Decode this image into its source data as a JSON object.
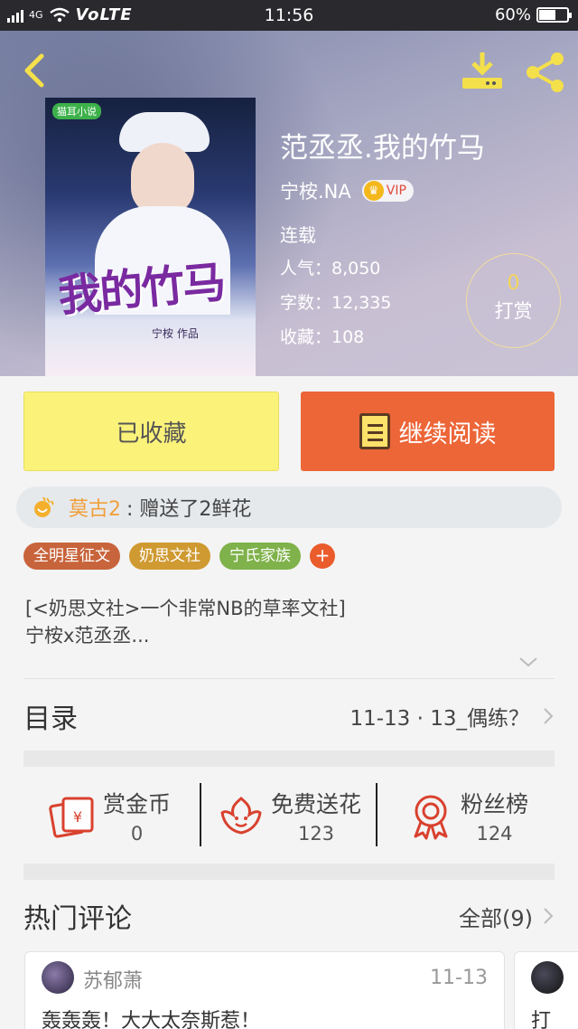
{
  "status_bar": {
    "network": "4G",
    "carrier_mode": "VoLTE",
    "time": "11:56",
    "battery": "60%",
    "battery_level": 0.6
  },
  "book": {
    "title": "范丞丞.我的竹马",
    "author": "宁桉.NA",
    "vip_label": "VIP",
    "status": "连载",
    "popularity": "人气：8,050",
    "word_count": "字数：12,335",
    "favorites": "收藏：108",
    "cover_logo": "猫耳小说",
    "cover_title": "我的竹马",
    "cover_author": "宁桉 作品"
  },
  "tip": {
    "count": "0",
    "label": "打赏"
  },
  "actions": {
    "favorited_label": "已收藏",
    "read_label": "继续阅读"
  },
  "gift": {
    "user": "莫古2",
    "text": ": 赠送了2鲜花"
  },
  "tags": [
    {
      "label": "全明星征文",
      "color": "#c8643c"
    },
    {
      "label": "奶思文社",
      "color": "#cf9a32"
    },
    {
      "label": "宁氏家族",
      "color": "#7fb24a"
    }
  ],
  "tag_add": "+",
  "intro": {
    "line1": "[<奶思文社>一个非常NB的草率文社]",
    "line2": "宁桉x范丞丞..."
  },
  "toc": {
    "title": "目录",
    "latest": "11-13 · 13_偶练？"
  },
  "stats": [
    {
      "label": "赏金币",
      "value": "0"
    },
    {
      "label": "免费送花",
      "value": "123"
    },
    {
      "label": "粉丝榜",
      "value": "124"
    }
  ],
  "comments_section": {
    "title": "热门评论",
    "all_label": "全部(9)"
  },
  "comments": [
    {
      "user": "苏郁萧",
      "date": "11-13",
      "content": "轰轰轰！大大太奈斯惹！"
    },
    {
      "content": "打"
    }
  ],
  "colors": {
    "accent_orange": "#ec6638",
    "fav_yellow": "#fbf27a",
    "icon_red": "#d9412e",
    "gift_orange": "#f0a03c"
  }
}
